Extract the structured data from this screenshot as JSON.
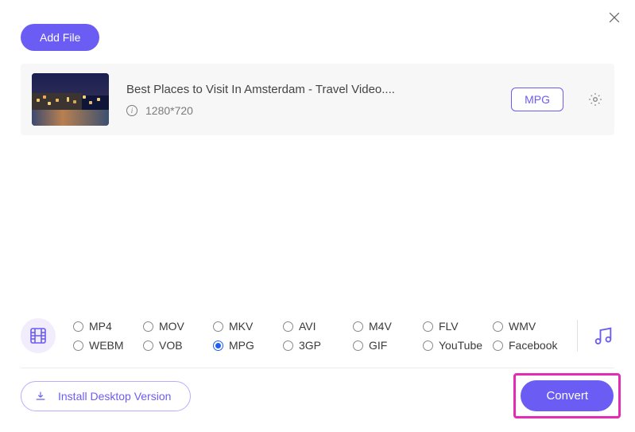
{
  "buttons": {
    "add_file": "Add File",
    "install_desktop": "Install Desktop Version",
    "convert": "Convert"
  },
  "file": {
    "title": "Best Places to Visit In Amsterdam - Travel Video....",
    "resolution": "1280*720",
    "current_format": "MPG"
  },
  "formats": {
    "selected": "MPG",
    "row1": [
      "MP4",
      "MOV",
      "MKV",
      "AVI",
      "M4V",
      "FLV",
      "WMV"
    ],
    "row2": [
      "WEBM",
      "VOB",
      "MPG",
      "3GP",
      "GIF",
      "YouTube",
      "Facebook"
    ]
  }
}
